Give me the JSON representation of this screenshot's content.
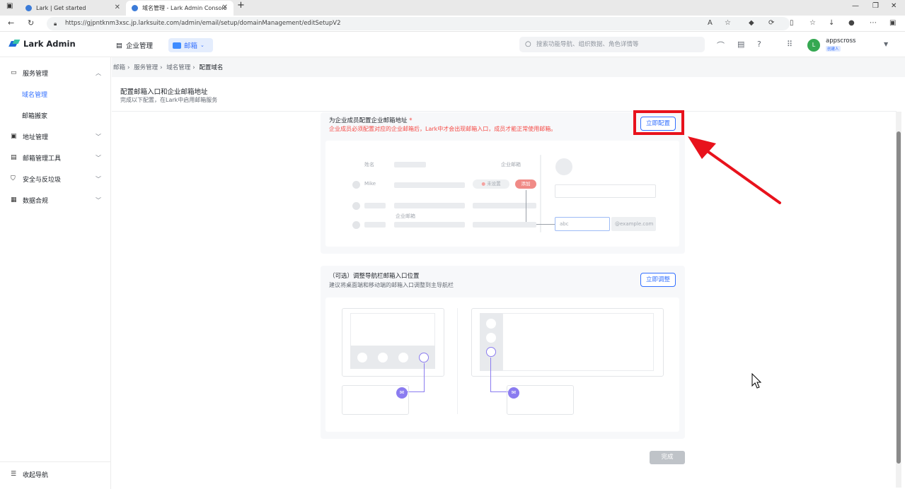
{
  "browser": {
    "tabs": [
      {
        "label": "Lark | Get started"
      },
      {
        "label": "域名管理 - Lark Admin Console"
      }
    ],
    "url": "https://gjpntknm3xsc.jp.larksuite.com/admin/email/setup/domainManagement/editSetupV2"
  },
  "header": {
    "brand": "Lark Admin",
    "nav_org": "企业管理",
    "nav_mail": "邮箱",
    "search_placeholder": "搜索功能导航、组织数据、角色详情等",
    "user_initial": "L",
    "user_name": "appscross",
    "user_role": "创建人"
  },
  "sidebar": {
    "items": [
      {
        "label": "服务管理"
      },
      {
        "label": "域名管理"
      },
      {
        "label": "邮箱搬家"
      },
      {
        "label": "地址管理"
      },
      {
        "label": "邮箱管理工具"
      },
      {
        "label": "安全与反垃圾"
      },
      {
        "label": "数据合规"
      }
    ],
    "collapse_label": "收起导航"
  },
  "breadcrumb": [
    "邮箱",
    "服务管理",
    "域名管理",
    "配置域名"
  ],
  "page": {
    "title": "配置邮箱入口和企业邮箱地址",
    "subtitle": "完成以下配置，在Lark中启用邮箱服务"
  },
  "step1": {
    "title": "为企业成员配置企业邮箱地址",
    "required_mark": "*",
    "warning": "企业成员必须配置对应的企业邮箱后，Lark中才会出现邮箱入口，成员才能正常使用邮箱。",
    "button": "立即配置",
    "illustration": {
      "col_name": "姓名",
      "col_email": "企业邮箱",
      "sample_name": "Mike",
      "status": "未设置",
      "add": "添加",
      "email_label": "企业邮箱",
      "input_value": "abc",
      "domain_suffix": "@example.com"
    }
  },
  "step2": {
    "title": "（可选）调整导航栏邮箱入口位置",
    "desc": "建议将桌面端和移动端的邮箱入口调整到主导航栏",
    "button": "立即调整"
  },
  "footer": {
    "done": "完成"
  },
  "colors": {
    "accent": "#3370ff",
    "warning": "#f54a45",
    "highlight": "#e8121c"
  }
}
